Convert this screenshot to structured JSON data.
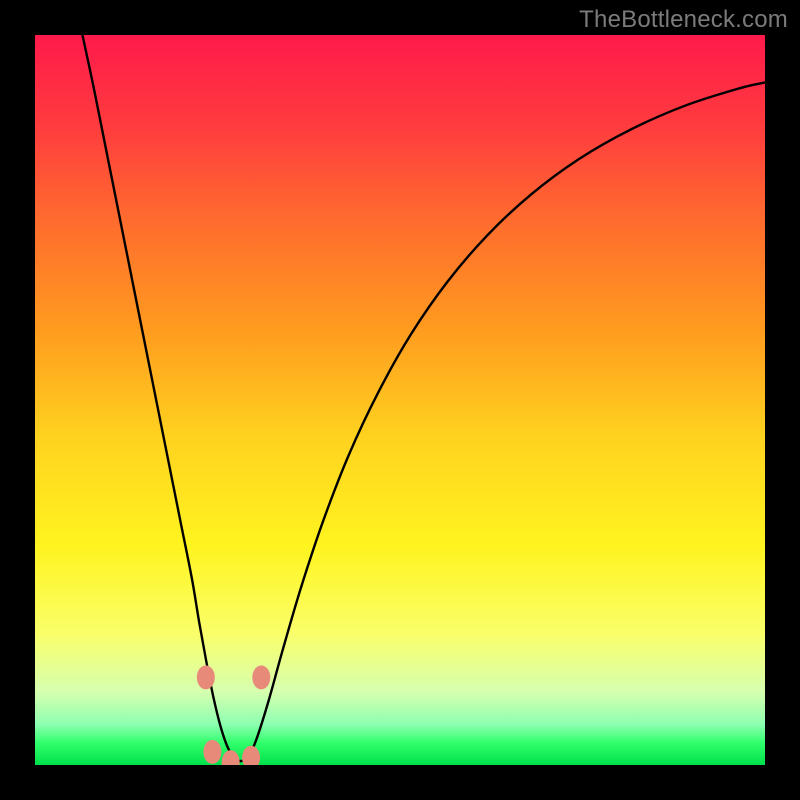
{
  "watermark": "TheBottleneck.com",
  "gradient": {
    "stops": [
      {
        "offset": 0.0,
        "color": "#ff1a4b"
      },
      {
        "offset": 0.12,
        "color": "#ff3a3f"
      },
      {
        "offset": 0.25,
        "color": "#ff6a2f"
      },
      {
        "offset": 0.4,
        "color": "#ff9a1f"
      },
      {
        "offset": 0.55,
        "color": "#ffd21f"
      },
      {
        "offset": 0.7,
        "color": "#fff41f"
      },
      {
        "offset": 0.82,
        "color": "#faff6a"
      },
      {
        "offset": 0.9,
        "color": "#d6ffb0"
      },
      {
        "offset": 0.945,
        "color": "#8cffb0"
      },
      {
        "offset": 0.97,
        "color": "#2fff6a"
      },
      {
        "offset": 1.0,
        "color": "#00e04a"
      }
    ]
  },
  "markers": {
    "color": "#e88a7a",
    "rx": 9,
    "ry": 12,
    "points": [
      {
        "x": 0.234,
        "y": 0.12
      },
      {
        "x": 0.31,
        "y": 0.12
      },
      {
        "x": 0.243,
        "y": 0.018
      },
      {
        "x": 0.268,
        "y": 0.004
      },
      {
        "x": 0.296,
        "y": 0.01
      }
    ]
  },
  "chart_data": {
    "type": "line",
    "title": "",
    "xlabel": "",
    "ylabel": "",
    "xlim": [
      0,
      1
    ],
    "ylim": [
      0,
      1
    ],
    "series": [
      {
        "name": "curve",
        "x": [
          0.065,
          0.08,
          0.095,
          0.11,
          0.125,
          0.14,
          0.155,
          0.17,
          0.185,
          0.2,
          0.215,
          0.225,
          0.235,
          0.245,
          0.255,
          0.265,
          0.275,
          0.285,
          0.295,
          0.305,
          0.32,
          0.34,
          0.365,
          0.395,
          0.43,
          0.47,
          0.515,
          0.565,
          0.62,
          0.68,
          0.745,
          0.815,
          0.89,
          0.965,
          1.0
        ],
        "y": [
          1.0,
          0.93,
          0.855,
          0.78,
          0.705,
          0.63,
          0.555,
          0.48,
          0.405,
          0.33,
          0.255,
          0.195,
          0.14,
          0.09,
          0.05,
          0.022,
          0.008,
          0.006,
          0.016,
          0.04,
          0.088,
          0.16,
          0.245,
          0.335,
          0.425,
          0.51,
          0.59,
          0.662,
          0.726,
          0.782,
          0.83,
          0.87,
          0.903,
          0.927,
          0.935
        ]
      }
    ]
  }
}
